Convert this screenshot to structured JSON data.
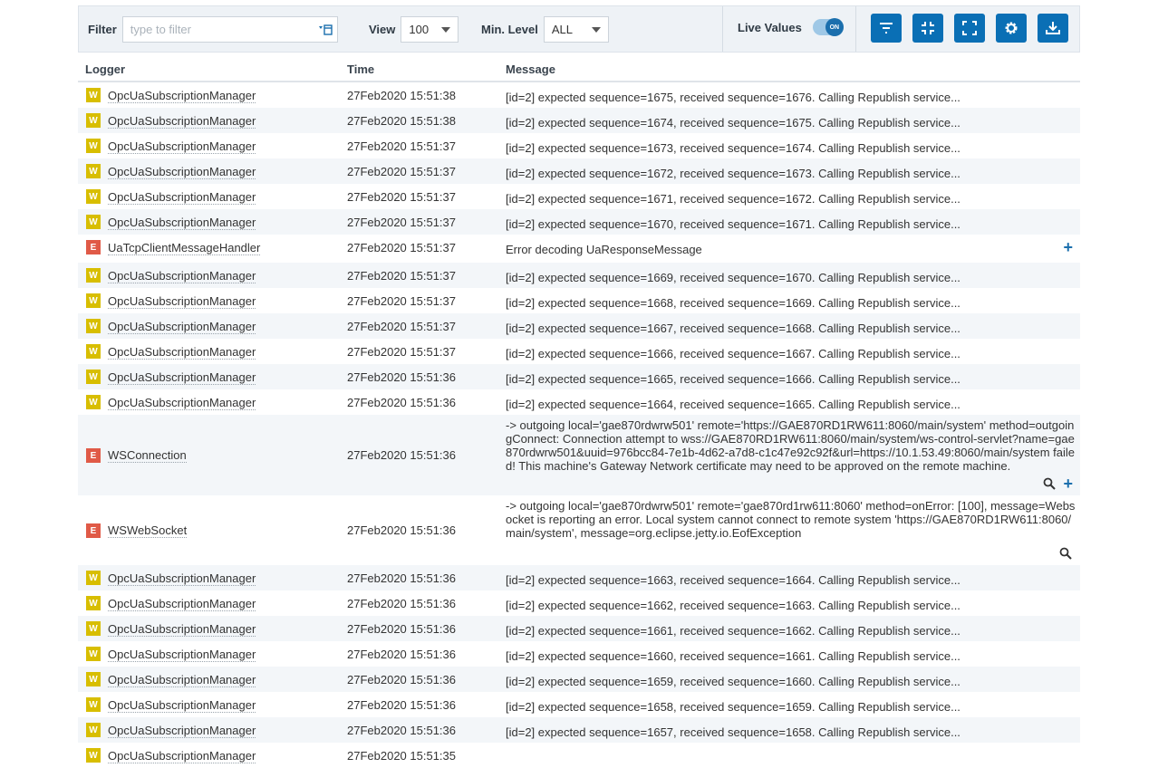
{
  "toolbar": {
    "filter_label": "Filter",
    "filter_placeholder": "type to filter",
    "filter_value": "",
    "view_label": "View",
    "view_value": "100",
    "minlevel_label": "Min. Level",
    "minlevel_value": "ALL",
    "live_label": "Live Values",
    "live_toggle_text": "ON",
    "accent_color": "#0a6fb5"
  },
  "table": {
    "headers": {
      "logger": "Logger",
      "time": "Time",
      "message": "Message"
    },
    "rows": [
      {
        "level": "W",
        "logger": "OpcUaSubscriptionManager",
        "time": "27Feb2020 15:51:38",
        "message": "[id=2] expected sequence=1675, received sequence=1676. Calling Republish service..."
      },
      {
        "level": "W",
        "logger": "OpcUaSubscriptionManager",
        "time": "27Feb2020 15:51:38",
        "message": "[id=2] expected sequence=1674, received sequence=1675. Calling Republish service..."
      },
      {
        "level": "W",
        "logger": "OpcUaSubscriptionManager",
        "time": "27Feb2020 15:51:37",
        "message": "[id=2] expected sequence=1673, received sequence=1674. Calling Republish service..."
      },
      {
        "level": "W",
        "logger": "OpcUaSubscriptionManager",
        "time": "27Feb2020 15:51:37",
        "message": "[id=2] expected sequence=1672, received sequence=1673. Calling Republish service..."
      },
      {
        "level": "W",
        "logger": "OpcUaSubscriptionManager",
        "time": "27Feb2020 15:51:37",
        "message": "[id=2] expected sequence=1671, received sequence=1672. Calling Republish service..."
      },
      {
        "level": "W",
        "logger": "OpcUaSubscriptionManager",
        "time": "27Feb2020 15:51:37",
        "message": "[id=2] expected sequence=1670, received sequence=1671. Calling Republish service..."
      },
      {
        "level": "E",
        "logger": "UaTcpClientMessageHandler",
        "time": "27Feb2020 15:51:37",
        "message": "Error decoding UaResponseMessage",
        "plus": true
      },
      {
        "level": "W",
        "logger": "OpcUaSubscriptionManager",
        "time": "27Feb2020 15:51:37",
        "message": "[id=2] expected sequence=1669, received sequence=1670. Calling Republish service..."
      },
      {
        "level": "W",
        "logger": "OpcUaSubscriptionManager",
        "time": "27Feb2020 15:51:37",
        "message": "[id=2] expected sequence=1668, received sequence=1669. Calling Republish service..."
      },
      {
        "level": "W",
        "logger": "OpcUaSubscriptionManager",
        "time": "27Feb2020 15:51:37",
        "message": "[id=2] expected sequence=1667, received sequence=1668. Calling Republish service..."
      },
      {
        "level": "W",
        "logger": "OpcUaSubscriptionManager",
        "time": "27Feb2020 15:51:37",
        "message": "[id=2] expected sequence=1666, received sequence=1667. Calling Republish service..."
      },
      {
        "level": "W",
        "logger": "OpcUaSubscriptionManager",
        "time": "27Feb2020 15:51:36",
        "message": "[id=2] expected sequence=1665, received sequence=1666. Calling Republish service..."
      },
      {
        "level": "W",
        "logger": "OpcUaSubscriptionManager",
        "time": "27Feb2020 15:51:36",
        "message": "[id=2] expected sequence=1664, received sequence=1665. Calling Republish service..."
      },
      {
        "level": "E",
        "logger": "WSConnection",
        "time": "27Feb2020 15:51:36",
        "message": "-> outgoing local='gae870rdwrw501' remote='https://GAE870RD1RW611:8060/main/system' method=outgoingConnect: Connection attempt to wss://GAE870RD1RW611:8060/main/system/ws-control-servlet?name=gae870rdwrw501&uuid=976bcc84-7e1b-4d62-a7d8-c1c47e92c92f&url=https://10.1.53.49:8060/main/system failed! This machine's Gateway Network certificate may need to be approved on the remote machine.",
        "plus": true,
        "search": true
      },
      {
        "level": "E",
        "logger": "WSWebSocket",
        "time": "27Feb2020 15:51:36",
        "message": "-> outgoing local='gae870rdwrw501' remote='gae870rd1rw611:8060' method=onError: [100], message=Websocket is reporting an error. Local system cannot connect to remote system 'https://GAE870RD1RW611:8060/main/system', message=org.eclipse.jetty.io.EofException",
        "search": true
      },
      {
        "level": "W",
        "logger": "OpcUaSubscriptionManager",
        "time": "27Feb2020 15:51:36",
        "message": "[id=2] expected sequence=1663, received sequence=1664. Calling Republish service..."
      },
      {
        "level": "W",
        "logger": "OpcUaSubscriptionManager",
        "time": "27Feb2020 15:51:36",
        "message": "[id=2] expected sequence=1662, received sequence=1663. Calling Republish service..."
      },
      {
        "level": "W",
        "logger": "OpcUaSubscriptionManager",
        "time": "27Feb2020 15:51:36",
        "message": "[id=2] expected sequence=1661, received sequence=1662. Calling Republish service..."
      },
      {
        "level": "W",
        "logger": "OpcUaSubscriptionManager",
        "time": "27Feb2020 15:51:36",
        "message": "[id=2] expected sequence=1660, received sequence=1661. Calling Republish service..."
      },
      {
        "level": "W",
        "logger": "OpcUaSubscriptionManager",
        "time": "27Feb2020 15:51:36",
        "message": "[id=2] expected sequence=1659, received sequence=1660. Calling Republish service..."
      },
      {
        "level": "W",
        "logger": "OpcUaSubscriptionManager",
        "time": "27Feb2020 15:51:36",
        "message": "[id=2] expected sequence=1658, received sequence=1659. Calling Republish service..."
      },
      {
        "level": "W",
        "logger": "OpcUaSubscriptionManager",
        "time": "27Feb2020 15:51:36",
        "message": "[id=2] expected sequence=1657, received sequence=1658. Calling Republish service..."
      },
      {
        "level": "W",
        "logger": "OpcUaSubscriptionManager",
        "time": "27Feb2020 15:51:35",
        "message": ""
      }
    ]
  }
}
